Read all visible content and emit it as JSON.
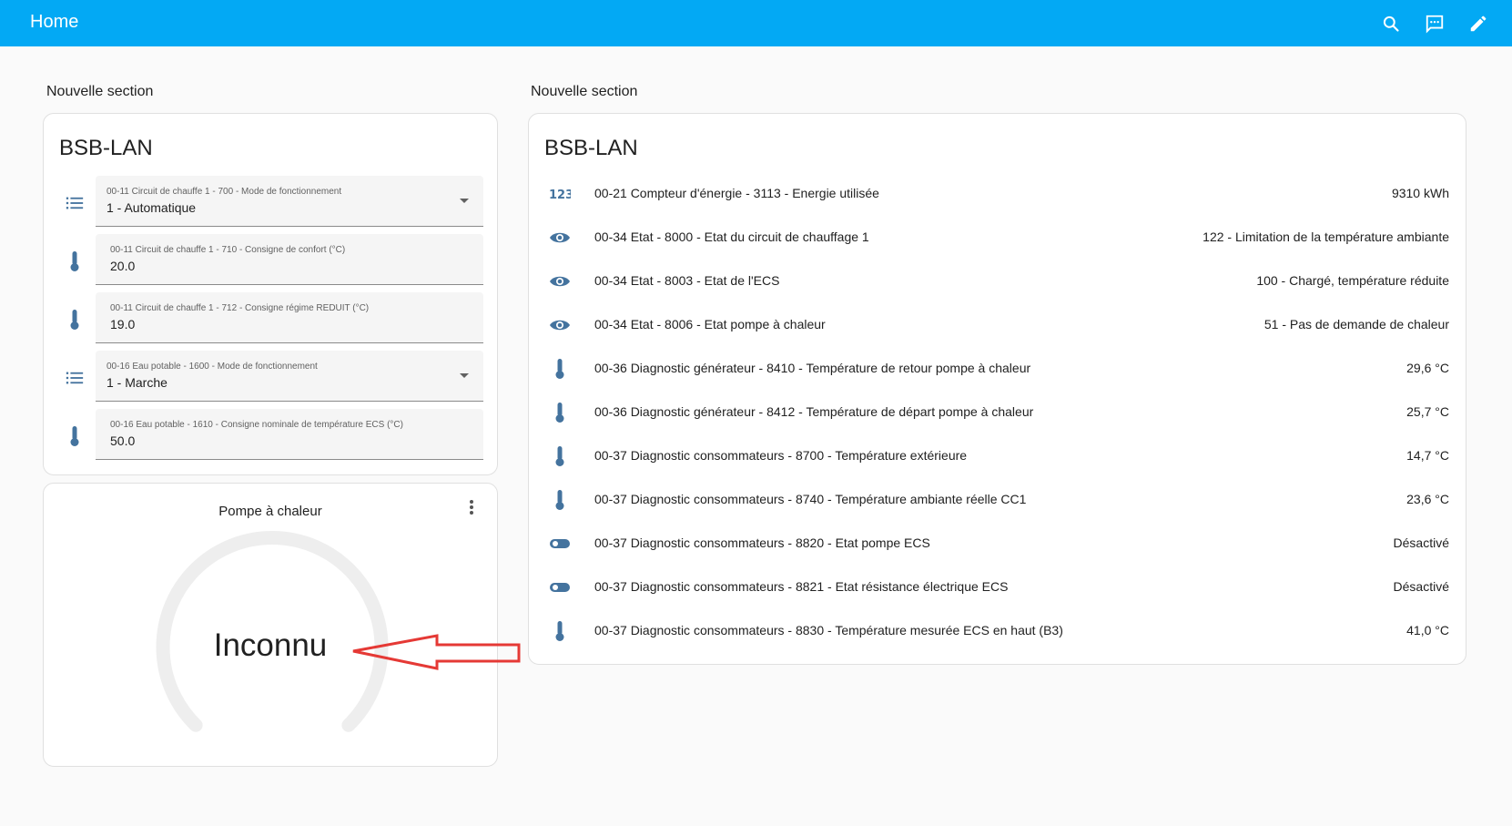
{
  "header": {
    "title": "Home",
    "accent_color": "#03a9f4",
    "actions": [
      {
        "icon": "search-icon"
      },
      {
        "icon": "assist-chat-icon"
      },
      {
        "icon": "pencil-icon"
      }
    ]
  },
  "left_section": {
    "title": "Nouvelle section",
    "card": {
      "title": "BSB-LAN",
      "fields": [
        {
          "label": "00-11 Circuit de chauffe 1 - 700 - Mode de fonctionnement",
          "value": "1 - Automatique",
          "type": "select",
          "icon": "list-icon"
        },
        {
          "label": "00-11 Circuit de chauffe 1 - 710 - Consigne de confort (°C)",
          "value": "20.0",
          "type": "number",
          "icon": "thermometer-icon"
        },
        {
          "label": "00-11 Circuit de chauffe 1 - 712 - Consigne régime REDUIT (°C)",
          "value": "19.0",
          "type": "number",
          "icon": "thermometer-icon"
        },
        {
          "label": "00-16 Eau potable - 1600 - Mode de fonctionnement",
          "value": "1 - Marche",
          "type": "select",
          "icon": "list-icon"
        },
        {
          "label": "00-16 Eau potable - 1610 - Consigne nominale de température ECS (°C)",
          "value": "50.0",
          "type": "number",
          "icon": "thermometer-icon"
        }
      ]
    },
    "gauge": {
      "title": "Pompe à chaleur",
      "value": "Inconnu"
    }
  },
  "right_section": {
    "title": "Nouvelle section",
    "card": {
      "title": "BSB-LAN",
      "entities": [
        {
          "icon": "counter-icon",
          "name": "00-21 Compteur d'énergie - 3113 - Energie utilisée",
          "state": "9310 kWh"
        },
        {
          "icon": "eye-icon",
          "name": "00-34 Etat - 8000 - Etat du circuit de chauffage 1",
          "state": "122 - Limitation de la température ambiante"
        },
        {
          "icon": "eye-icon",
          "name": "00-34 Etat - 8003 - Etat de l'ECS",
          "state": "100 - Chargé, température réduite"
        },
        {
          "icon": "eye-icon",
          "name": "00-34 Etat - 8006 - Etat pompe à chaleur",
          "state": "51 - Pas de demande de chaleur"
        },
        {
          "icon": "thermometer-icon",
          "name": "00-36 Diagnostic générateur - 8410 - Température de retour pompe à chaleur",
          "state": "29,6 °C"
        },
        {
          "icon": "thermometer-icon",
          "name": "00-36 Diagnostic générateur - 8412 - Température de départ pompe à chaleur",
          "state": "25,7 °C"
        },
        {
          "icon": "thermometer-icon",
          "name": "00-37 Diagnostic consommateurs - 8700 - Température extérieure",
          "state": "14,7 °C"
        },
        {
          "icon": "thermometer-icon",
          "name": "00-37 Diagnostic consommateurs - 8740 - Température ambiante réelle CC1",
          "state": "23,6 °C"
        },
        {
          "icon": "toggle-icon",
          "name": "00-37 Diagnostic consommateurs - 8820 - Etat pompe ECS",
          "state": "Désactivé"
        },
        {
          "icon": "toggle-icon",
          "name": "00-37 Diagnostic consommateurs - 8821 - Etat résistance électrique ECS",
          "state": "Désactivé"
        },
        {
          "icon": "thermometer-icon",
          "name": "00-37 Diagnostic consommateurs - 8830 - Température mesurée ECS en haut (B3)",
          "state": "41,0 °C"
        }
      ]
    }
  },
  "icon_color": "#44739e",
  "annotation_arrow_color": "#e53935"
}
